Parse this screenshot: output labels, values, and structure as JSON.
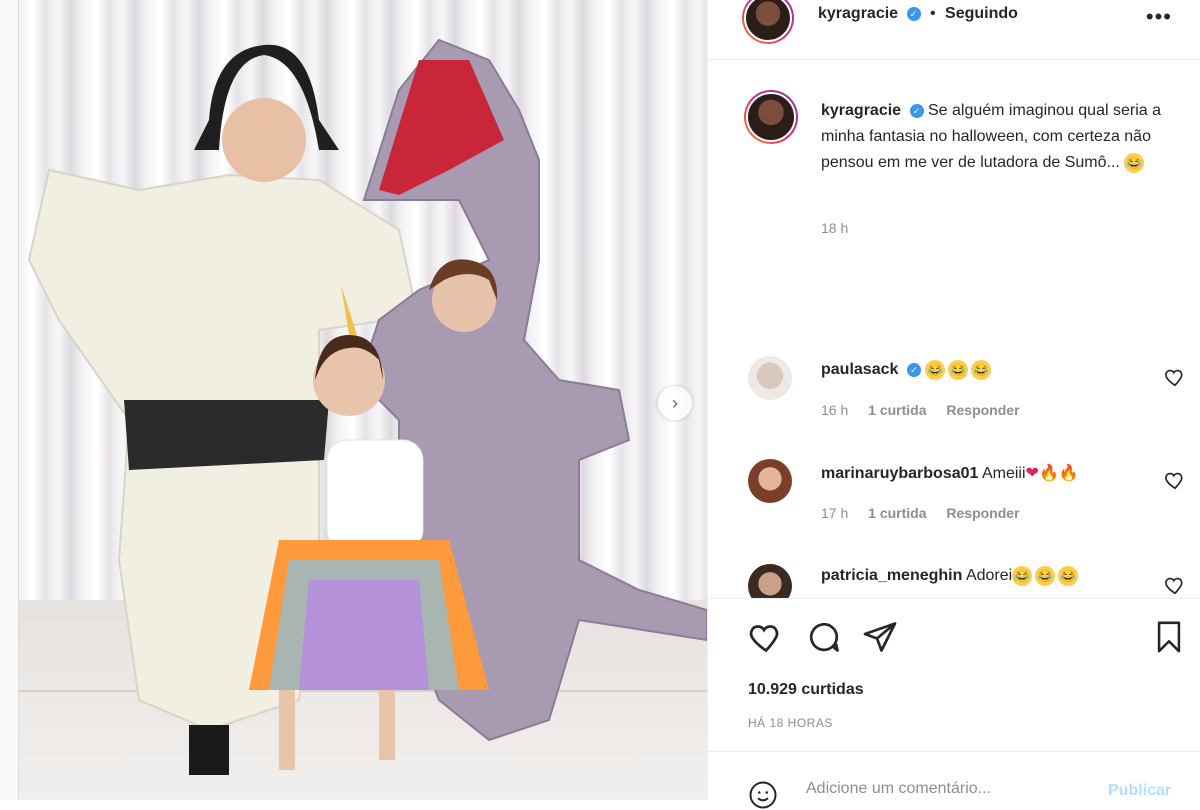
{
  "post": {
    "author": "kyragracie",
    "separator": "•",
    "follow_status": "Seguindo",
    "more_label": "•••",
    "next_icon": "chevron-right-icon"
  },
  "caption": {
    "author": "kyragracie",
    "text": "Se alguém imaginou qual seria a minha fantasia no halloween, com certeza não pensou em me ver de lutadora de Sumô...",
    "time": "18 h"
  },
  "comments": [
    {
      "user": "paulasack",
      "verified": true,
      "text": "",
      "emoji_count": 3,
      "time": "16 h",
      "likes": "1 curtida",
      "reply": "Responder"
    },
    {
      "user": "marinaruybarbosa01",
      "verified": false,
      "text": "Ameiii",
      "emoji_count": 0,
      "time": "17 h",
      "likes": "1 curtida",
      "reply": "Responder"
    },
    {
      "user": "patricia_meneghin",
      "verified": false,
      "text": "Adorei",
      "emoji_count": 3,
      "time": "",
      "likes": "",
      "reply": ""
    }
  ],
  "actions": {
    "likes_count": "10.929 curtidas",
    "time_ago": "HÁ 18 HORAS"
  },
  "composer": {
    "placeholder": "Adicione um comentário...",
    "publish_label": "Publicar"
  },
  "colors": {
    "verified": "#3897f0",
    "publish_disabled": "#b2dffc",
    "muted": "#8e8e8e",
    "text": "#262626"
  }
}
